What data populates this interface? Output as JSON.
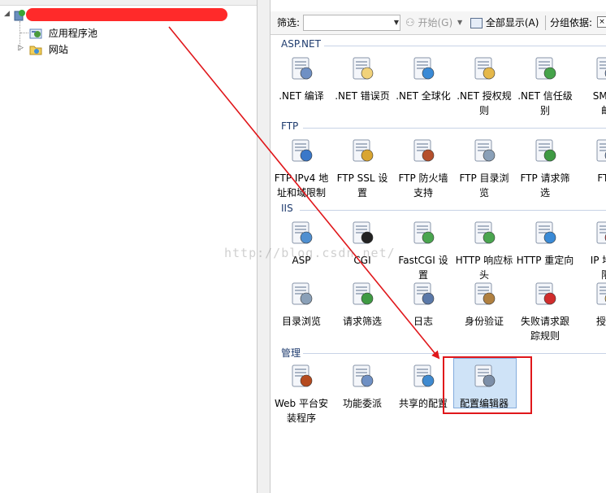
{
  "tree": {
    "root_redacted": true,
    "items": [
      {
        "label": "应用程序池",
        "icon": "app-pool-icon"
      },
      {
        "label": "网站",
        "icon": "sites-folder-icon"
      }
    ]
  },
  "toolbar": {
    "filter_label": "筛选:",
    "filter_value": "",
    "start_label": "开始(G)",
    "show_all_label": "全部显示(A)",
    "group_by_label": "分组依据:"
  },
  "sections": [
    {
      "title": "ASP.NET",
      "items": [
        {
          "label": ".NET 编译",
          "icon": "net-compile-icon"
        },
        {
          "label": ".NET 错误页",
          "icon": "net-error-pages-icon"
        },
        {
          "label": ".NET 全球化",
          "icon": "net-globalization-icon"
        },
        {
          "label": ".NET 授权规\n则",
          "icon": "net-authorization-icon"
        },
        {
          "label": ".NET 信任级\n别",
          "icon": "net-trust-levels-icon"
        },
        {
          "label": "SMTP\n邮",
          "icon": "smtp-email-icon"
        }
      ]
    },
    {
      "title": "FTP",
      "items": [
        {
          "label": "FTP IPv4 地\n址和域限制",
          "icon": "ftp-ipv4-restrictions-icon"
        },
        {
          "label": "FTP SSL 设\n置",
          "icon": "ftp-ssl-icon"
        },
        {
          "label": "FTP 防火墙\n支持",
          "icon": "ftp-firewall-icon"
        },
        {
          "label": "FTP 目录浏\n览",
          "icon": "ftp-directory-browsing-icon"
        },
        {
          "label": "FTP 请求筛\n选",
          "icon": "ftp-request-filtering-icon"
        },
        {
          "label": "FTP",
          "icon": "ftp-more-icon"
        }
      ]
    },
    {
      "title": "IIS",
      "items": [
        {
          "label": "ASP",
          "icon": "asp-icon"
        },
        {
          "label": "CGI",
          "icon": "cgi-icon"
        },
        {
          "label": "FastCGI 设\n置",
          "icon": "fastcgi-icon"
        },
        {
          "label": "HTTP 响应标\n头",
          "icon": "http-response-headers-icon"
        },
        {
          "label": "HTTP 重定向",
          "icon": "http-redirect-icon"
        },
        {
          "label": "IP 地址\n限",
          "icon": "ip-restrictions-icon"
        },
        {
          "label": "目录浏览",
          "icon": "directory-browsing-icon"
        },
        {
          "label": "请求筛选",
          "icon": "request-filtering-icon"
        },
        {
          "label": "日志",
          "icon": "logging-icon"
        },
        {
          "label": "身份验证",
          "icon": "authentication-icon"
        },
        {
          "label": "失败请求跟\n踪规则",
          "icon": "failed-request-tracing-icon"
        },
        {
          "label": "授权",
          "icon": "authorization-icon"
        }
      ]
    },
    {
      "title": "管理",
      "items": [
        {
          "label": "Web 平台安\n装程序",
          "icon": "web-platform-installer-icon"
        },
        {
          "label": "功能委派",
          "icon": "feature-delegation-icon"
        },
        {
          "label": "共享的配置",
          "icon": "shared-configuration-icon"
        },
        {
          "label": "配置编辑器",
          "icon": "configuration-editor-icon",
          "selected": true
        }
      ]
    }
  ],
  "watermark": "http://blog.csdn.net/",
  "colors": {
    "annotation": "#e0171b",
    "section_title": "#1e3b6e",
    "selection": "#cfe3f7"
  }
}
